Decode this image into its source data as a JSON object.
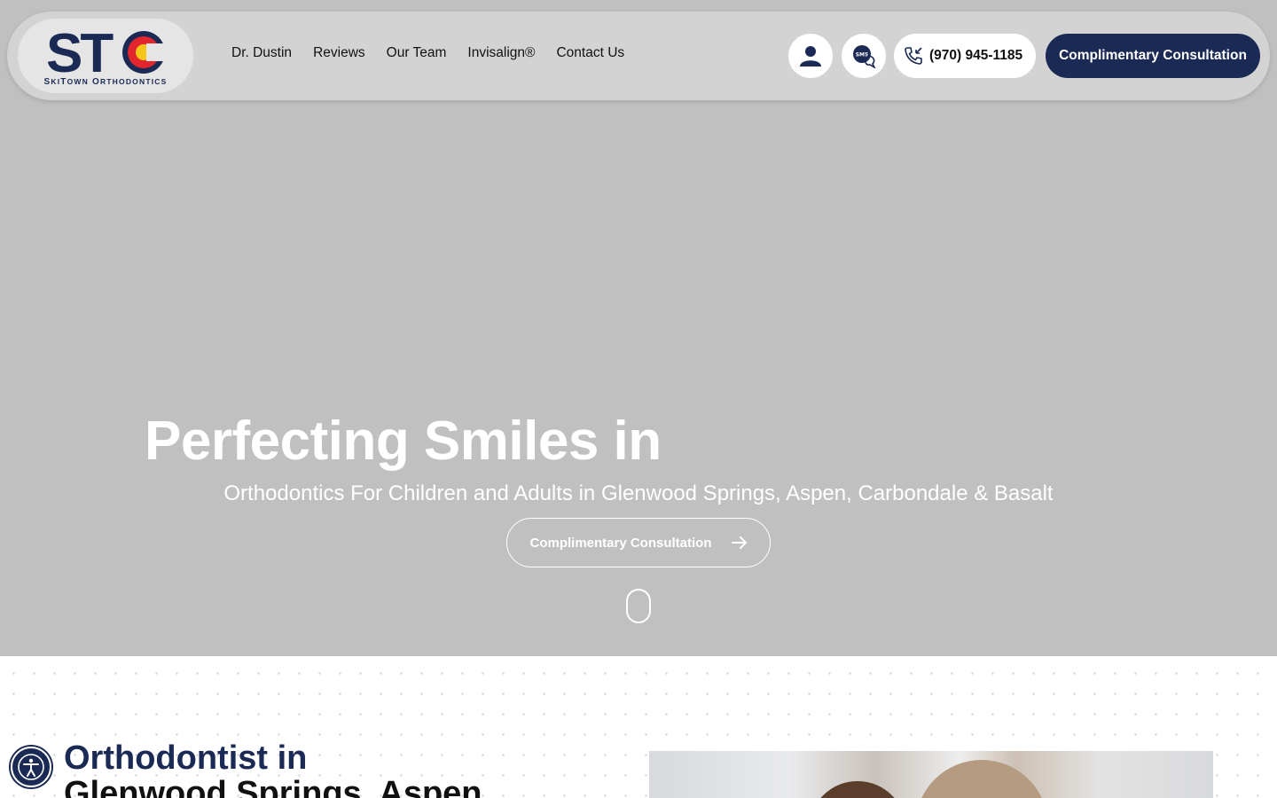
{
  "brand": {
    "logo_letters": "STC",
    "logo_subtitle_s": "S",
    "logo_subtitle_ki": "KI",
    "logo_subtitle_t": "T",
    "logo_subtitle_own": "OWN",
    "logo_subtitle_o": "O",
    "logo_subtitle_rthodontics": "RTHODONTICS",
    "colors": {
      "navy": "#1b2a55",
      "red": "#e3262d",
      "yellow": "#f5c518"
    }
  },
  "nav": {
    "links": [
      {
        "label": "Dr. Dustin"
      },
      {
        "label": "Reviews"
      },
      {
        "label": "Our Team"
      },
      {
        "label": "Invisalign®"
      },
      {
        "label": "Contact Us"
      }
    ],
    "account_icon": "user-icon",
    "sms_icon": "sms-chat-icon",
    "phone_icon": "phone-icon",
    "phone": "(970) 945-1185",
    "cta_label": "Complimentary Consultation"
  },
  "hero": {
    "title": "Perfecting Smiles in",
    "subtitle": "Orthodontics For Children and Adults in Glenwood Springs, Aspen, Carbondale & Basalt",
    "button_label": "Complimentary Consultation",
    "button_icon": "arrow-right-icon",
    "scroll_icon": "mouse-scroll-icon"
  },
  "intro": {
    "title_line1": "Orthodontist in",
    "title_line2": "Glenwood Springs, Aspen",
    "accessibility_icon": "accessibility-icon"
  }
}
